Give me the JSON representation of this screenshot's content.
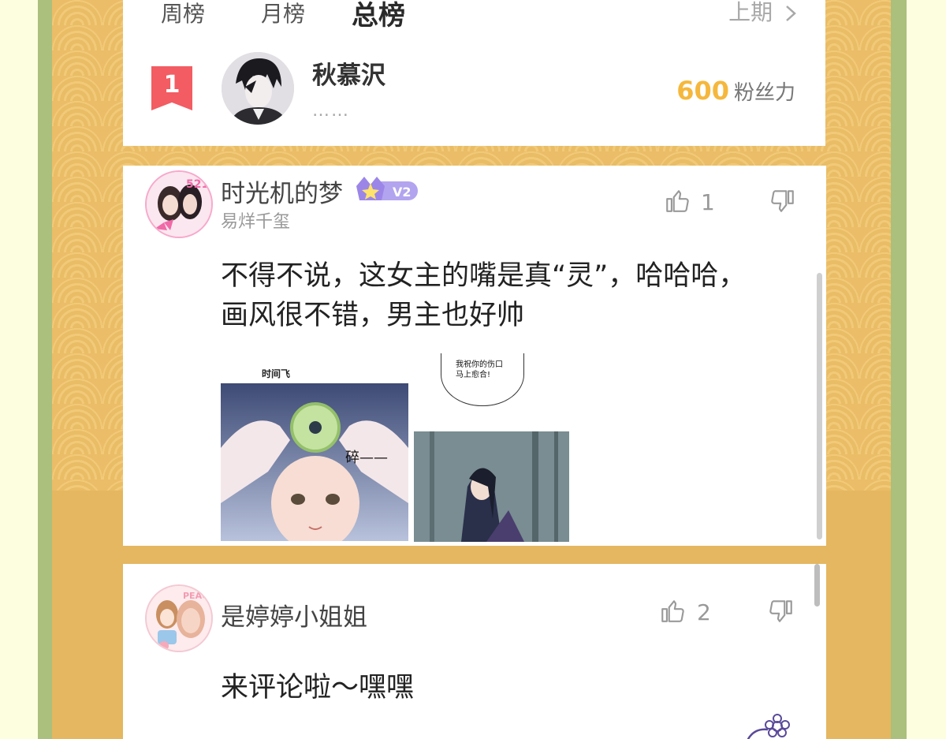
{
  "tabs": [
    "周榜",
    "月榜",
    "总榜"
  ],
  "active_tab": "总榜",
  "prev_period": "上期",
  "ranking": {
    "rank": "1",
    "name": "秋慕沢",
    "bio": "……",
    "fans_value": "600",
    "fans_unit": "粉丝力"
  },
  "comments": [
    {
      "username": "时光机的梦",
      "level": "V2",
      "subtitle": "易烊千玺",
      "likes": "1",
      "text": "不得不说，这女主的嘴是真“灵”，哈哈哈，画风很不错，男主也好帅",
      "images": [
        {
          "caption_top": "时间飞",
          "sfx": "碎——"
        },
        {
          "bubble": "我祝你的伤口马上愈合!"
        }
      ]
    },
    {
      "username": "是婷婷小姐姐",
      "likes": "2",
      "text": "来评论啦～嘿嘿"
    }
  ],
  "icons": {
    "like": "thumbs-up-icon",
    "dislike": "thumbs-down-icon",
    "chevron": "chevron-right-icon",
    "deco": "flower-icon"
  },
  "colors": {
    "frame_green": "#abc07c",
    "panel_orange": "#e4b760",
    "rank_red": "#f25c62",
    "fans_gold": "#f5b83d",
    "badge_purple": "#9b86e8"
  }
}
